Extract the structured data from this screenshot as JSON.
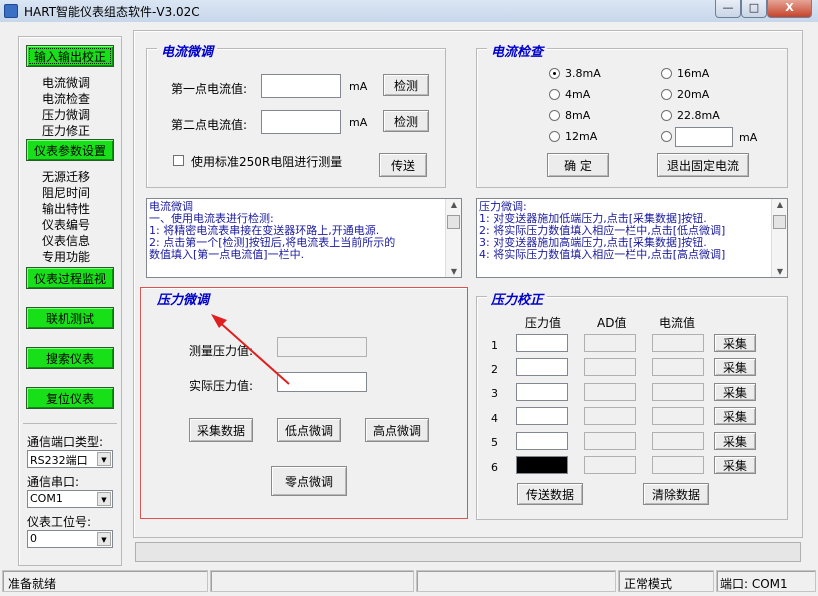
{
  "window": {
    "title": "HART智能仪表组态软件-V3.02C",
    "min": "—",
    "max": "□",
    "close": "X"
  },
  "sidebar": {
    "btn_io_calibration": "输入输出校正",
    "io_items": [
      "电流微调",
      "电流检查",
      "压力微调",
      "压力修正"
    ],
    "btn_param_settings": "仪表参数设置",
    "param_items": [
      "无源迁移",
      "阻尼时间",
      "输出特性",
      "仪表编号",
      "仪表信息",
      "专用功能"
    ],
    "btn_process_monitor": "仪表过程监视",
    "btn_online_test": "联机测试",
    "btn_search": "搜索仪表",
    "btn_reset": "复位仪表",
    "port_type_label": "通信端口类型:",
    "port_type_value": "RS232端口",
    "serial_label": "通信串口:",
    "serial_value": "COM1",
    "station_label": "仪表工位号:",
    "station_value": "0"
  },
  "current_trim": {
    "title": "电流微调",
    "first_label": "第一点电流值:",
    "second_label": "第二点电流值:",
    "unit": "mA",
    "detect1": "检测",
    "detect2": "检测",
    "std_resistor_label": "使用标准250R电阻进行测量",
    "send": "传送"
  },
  "current_check": {
    "title": "电流检查",
    "options": [
      "3.8mA",
      "4mA",
      "8mA",
      "12mA",
      "16mA",
      "20mA",
      "22.8mA"
    ],
    "custom_unit": "mA",
    "confirm": "确 定",
    "exit": "退出固定电流"
  },
  "help_left": [
    "电流微调",
    "一、使用电流表进行检测:",
    "  1: 将精密电流表串接在变送器环路上,开通电源.",
    "  2: 点击第一个[检测]按钮后,将电流表上当前所示的",
    "     数值填入[第一点电流值]一栏中."
  ],
  "help_right": [
    "压力微调:",
    "1: 对变送器施加低端压力,点击[采集数据]按钮.",
    "2: 将实际压力数值填入相应一栏中,点击[低点微调]",
    "3: 对变送器施加高端压力,点击[采集数据]按钮.",
    "4: 将实际压力数值填入相应一栏中,点击[高点微调]"
  ],
  "pressure_trim": {
    "title": "压力微调",
    "measured_label": "测量压力值:",
    "actual_label": "实际压力值:",
    "collect": "采集数据",
    "low_trim": "低点微调",
    "high_trim": "高点微调",
    "zero_trim": "零点微调"
  },
  "pressure_calib": {
    "title": "压力校正",
    "col_pressure": "压力值",
    "col_ad": "AD值",
    "col_current": "电流值",
    "rows": [
      "1",
      "2",
      "3",
      "4",
      "5",
      "6"
    ],
    "collect": "采集",
    "send": "传送数据",
    "clear": "清除数据"
  },
  "status": {
    "ready": "准备就绪",
    "mode": "正常模式",
    "port": "端口: COM1"
  }
}
